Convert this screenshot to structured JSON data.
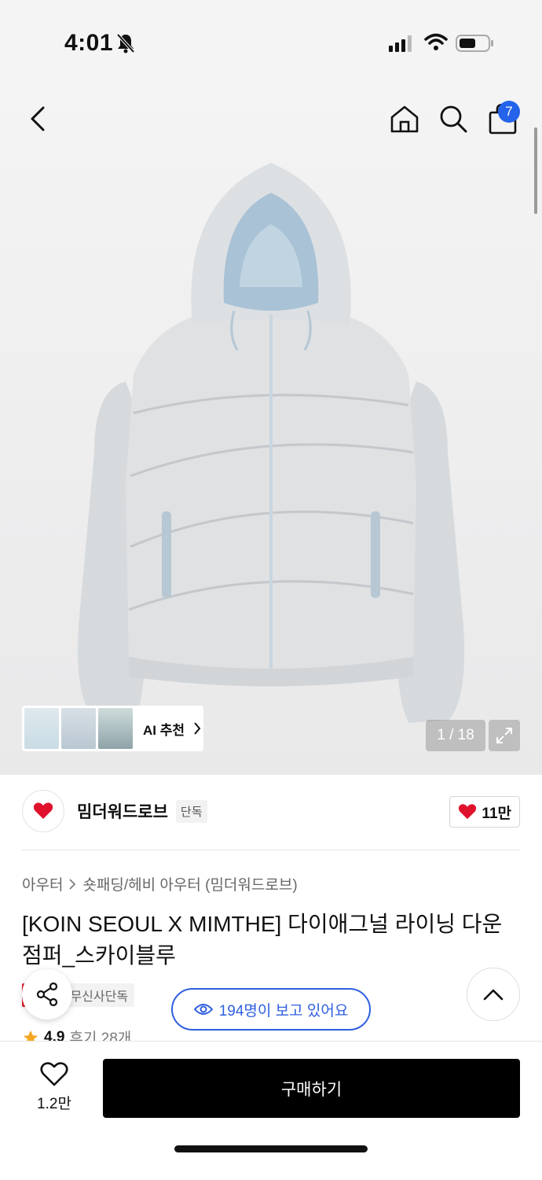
{
  "status_bar": {
    "time": "4:01",
    "icons": [
      "bell-slash-icon",
      "signal-icon",
      "wifi-icon",
      "battery-icon"
    ]
  },
  "header": {
    "cart_count": "7",
    "icons": [
      "back-icon",
      "home-icon",
      "search-icon",
      "cart-icon"
    ]
  },
  "gallery": {
    "ai_label": "AI 추천",
    "page_indicator": "1 / 18"
  },
  "brand": {
    "name": "밈더워드로브",
    "tag": "단독",
    "likes": "11만"
  },
  "product": {
    "breadcrumb": [
      "아우터",
      "숏패딩/헤비 아우터 (밈더워드로브)"
    ],
    "title": "[KOIN SEOUL X MIMTHE] 다이애그널 라이닝 다운 점퍼_스카이블루",
    "tag_sale": "세일",
    "tag_exclusive": "무신사단독",
    "viewers": "194명이 보고 있어요",
    "rating": "4.9",
    "reviews": "후기 28개"
  },
  "bottom_bar": {
    "wish_count": "1.2만",
    "buy_label": "구매하기"
  },
  "colors": {
    "accent_blue": "#2563eb",
    "sale_red": "#e11d2a",
    "heart_red": "#e0112b",
    "star": "#f5a623"
  }
}
